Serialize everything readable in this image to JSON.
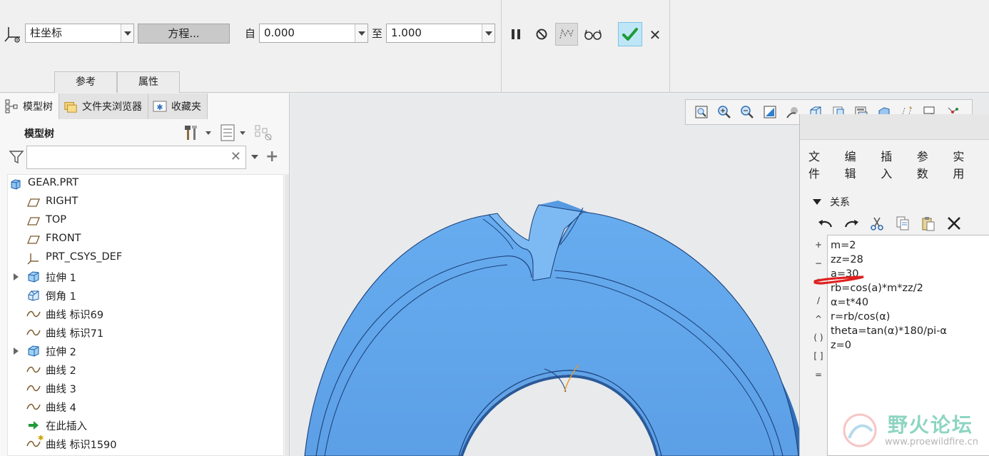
{
  "ribbon": {
    "coord_type": "柱坐标",
    "equation_button": "方程...",
    "from_label": "自",
    "from_value": "0.000",
    "to_label": "至",
    "to_value": "1.000",
    "tabs": [
      "参考",
      "属性"
    ]
  },
  "left_panel": {
    "tabs": [
      {
        "label": "模型树",
        "icon": "model-tree-icon"
      },
      {
        "label": "文件夹浏览器",
        "icon": "folder-browser-icon"
      },
      {
        "label": "收藏夹",
        "icon": "favorites-icon"
      }
    ],
    "tree_title": "模型树",
    "filter_placeholder": "",
    "tree_items": [
      {
        "label": "GEAR.PRT",
        "icon": "part-icon",
        "expandable": false,
        "indent": 0
      },
      {
        "label": "RIGHT",
        "icon": "datum-plane-icon",
        "expandable": false,
        "indent": 1
      },
      {
        "label": "TOP",
        "icon": "datum-plane-icon",
        "expandable": false,
        "indent": 1
      },
      {
        "label": "FRONT",
        "icon": "datum-plane-icon",
        "expandable": false,
        "indent": 1
      },
      {
        "label": "PRT_CSYS_DEF",
        "icon": "csys-icon",
        "expandable": false,
        "indent": 1
      },
      {
        "label": "拉伸 1",
        "icon": "extrude-icon",
        "expandable": true,
        "indent": 1
      },
      {
        "label": "倒角 1",
        "icon": "chamfer-icon",
        "expandable": false,
        "indent": 1
      },
      {
        "label": "曲线 标识69",
        "icon": "curve-icon",
        "expandable": false,
        "indent": 1
      },
      {
        "label": "曲线 标识71",
        "icon": "curve-icon",
        "expandable": false,
        "indent": 1
      },
      {
        "label": "拉伸 2",
        "icon": "extrude-icon",
        "expandable": true,
        "indent": 1
      },
      {
        "label": "曲线 2",
        "icon": "curve-icon",
        "expandable": false,
        "indent": 1
      },
      {
        "label": "曲线 3",
        "icon": "curve-icon",
        "expandable": false,
        "indent": 1
      },
      {
        "label": "曲线 4",
        "icon": "curve-icon",
        "expandable": false,
        "indent": 1
      },
      {
        "label": "在此插入",
        "icon": "insert-here-icon",
        "expandable": false,
        "indent": 1
      },
      {
        "label": "曲线 标识1590",
        "icon": "curve-new-icon",
        "expandable": false,
        "indent": 1
      }
    ]
  },
  "dialog": {
    "menus": [
      "文件",
      "编辑",
      "插入",
      "参数",
      "实用"
    ],
    "section_label": "关系",
    "operators": [
      "+",
      "−",
      "*",
      "/",
      "^",
      "( )",
      "[ ]",
      "="
    ],
    "relations": [
      "m=2",
      "zz=28",
      "a=30",
      "rb=cos(a)*m*zz/2",
      "α=t*40",
      "r=rb/cos(α)",
      "theta=tan(α)*180/pi-α",
      "z=0"
    ]
  },
  "watermark": {
    "title": "野火论坛",
    "url": "www.proewildfire.cn"
  },
  "colors": {
    "gear_face": "#5ea6ec",
    "gear_side": "#3f7fc8",
    "ok_button": "#bfe6f7",
    "highlight": "#e02020"
  }
}
